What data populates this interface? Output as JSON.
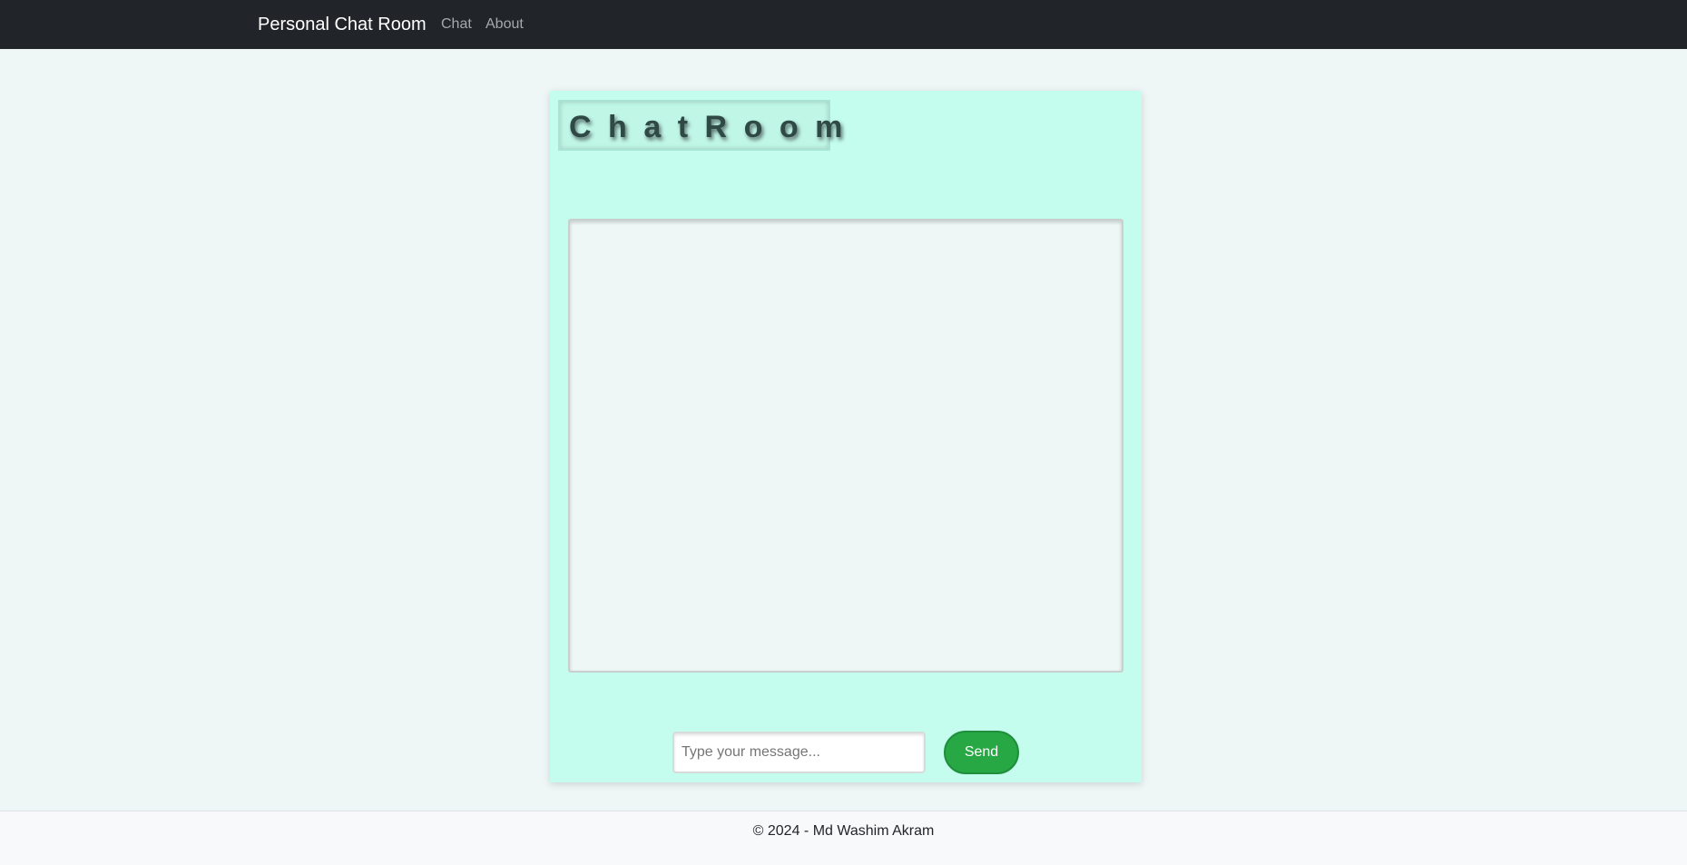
{
  "navbar": {
    "brand": "Personal Chat Room",
    "links": [
      "Chat",
      "About"
    ]
  },
  "chat": {
    "title": "ChatRoom",
    "messages": [],
    "input_placeholder": "Type your message...",
    "input_value": "",
    "send_label": "Send"
  },
  "footer": {
    "text": "© 2024 - Md Washim Akram"
  },
  "colors": {
    "navbar_bg": "#212529",
    "page_bg": "#eef7f6",
    "panel_bg": "#c4fcee",
    "send_button": "#28a745",
    "footer_bg": "#f8f9fa"
  }
}
